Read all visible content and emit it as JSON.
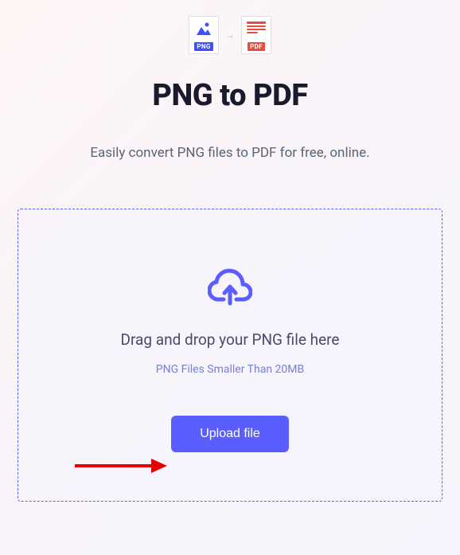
{
  "header": {
    "png_badge": "PNG",
    "pdf_badge": "PDF",
    "title": "PNG to PDF",
    "subtitle": "Easily convert PNG files to PDF for free, online."
  },
  "upload": {
    "drag_text": "Drag and drop your PNG file here",
    "file_hint": "PNG Files Smaller Than 20MB",
    "button_label": "Upload file"
  },
  "colors": {
    "accent": "#5a5eff",
    "png_blue": "#3f51ff",
    "pdf_red": "#e74c3c"
  }
}
